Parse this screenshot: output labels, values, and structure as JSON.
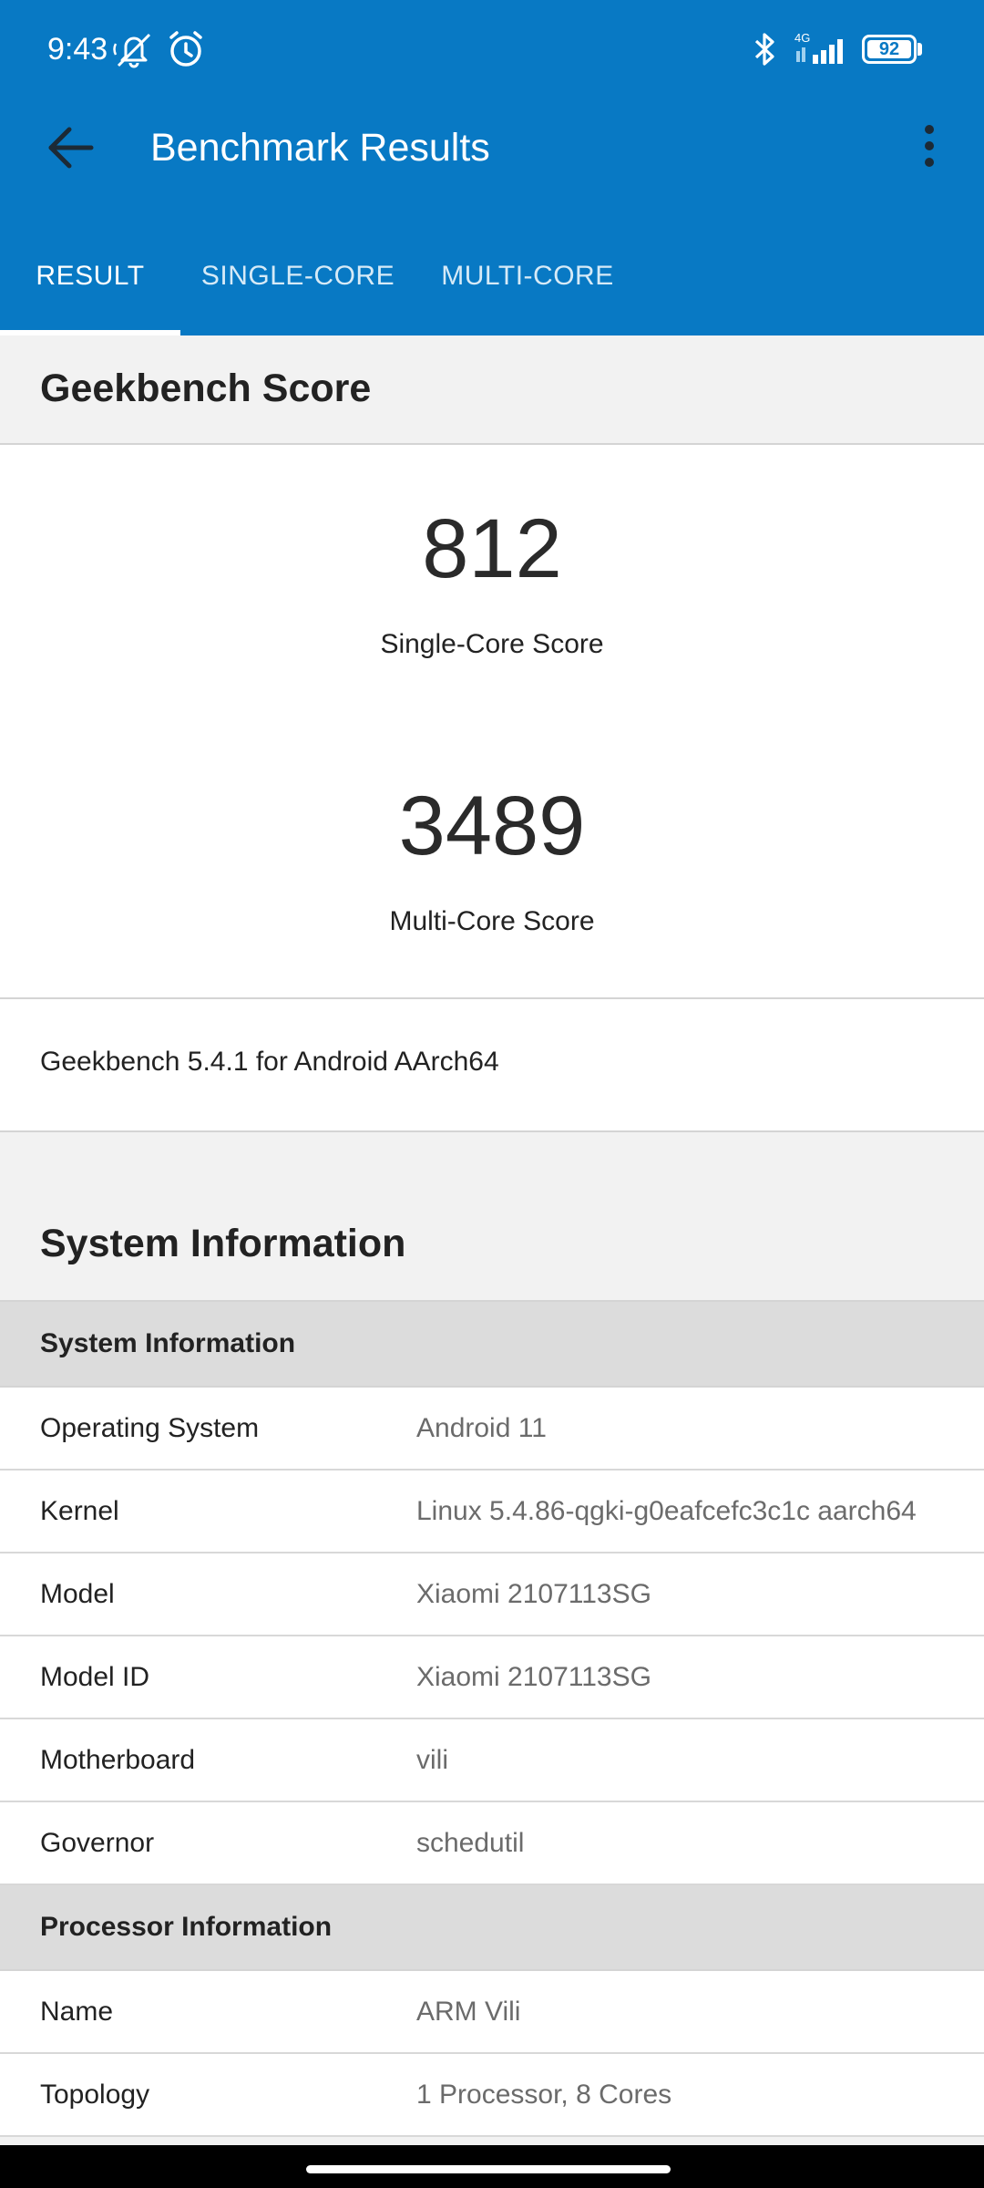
{
  "status_bar": {
    "time": "9:43",
    "network": "4G",
    "battery": "92",
    "icons": [
      "mute-off-icon",
      "alarm-icon",
      "bluetooth-icon",
      "signal-icon",
      "battery-icon"
    ]
  },
  "toolbar": {
    "title": "Benchmark Results",
    "back_icon": "arrow-back-icon",
    "menu_icon": "more-vert-icon"
  },
  "tabs": [
    {
      "label": "RESULT",
      "active": true
    },
    {
      "label": "SINGLE-CORE",
      "active": false
    },
    {
      "label": "MULTI-CORE",
      "active": false
    }
  ],
  "geekbench": {
    "section_title": "Geekbench Score",
    "single_core_score": "812",
    "single_core_label": "Single-Core Score",
    "multi_core_score": "3489",
    "multi_core_label": "Multi-Core Score",
    "version": "Geekbench 5.4.1 for Android AArch64"
  },
  "system_info": {
    "section_title": "System Information",
    "groups": [
      {
        "title": "System Information",
        "rows": [
          {
            "key": "Operating System",
            "value": "Android 11"
          },
          {
            "key": "Kernel",
            "value": "Linux 5.4.86-qgki-g0eafcefc3c1c aarch64"
          },
          {
            "key": "Model",
            "value": "Xiaomi 2107113SG"
          },
          {
            "key": "Model ID",
            "value": "Xiaomi 2107113SG"
          },
          {
            "key": "Motherboard",
            "value": "vili"
          },
          {
            "key": "Governor",
            "value": "schedutil"
          }
        ]
      },
      {
        "title": "Processor Information",
        "rows": [
          {
            "key": "Name",
            "value": "ARM Vili"
          },
          {
            "key": "Topology",
            "value": "1 Processor, 8 Cores"
          }
        ]
      }
    ]
  },
  "colors": {
    "app_bar": "#0879c4",
    "background": "#f2f2f2",
    "group_header": "#dcdcdc"
  }
}
